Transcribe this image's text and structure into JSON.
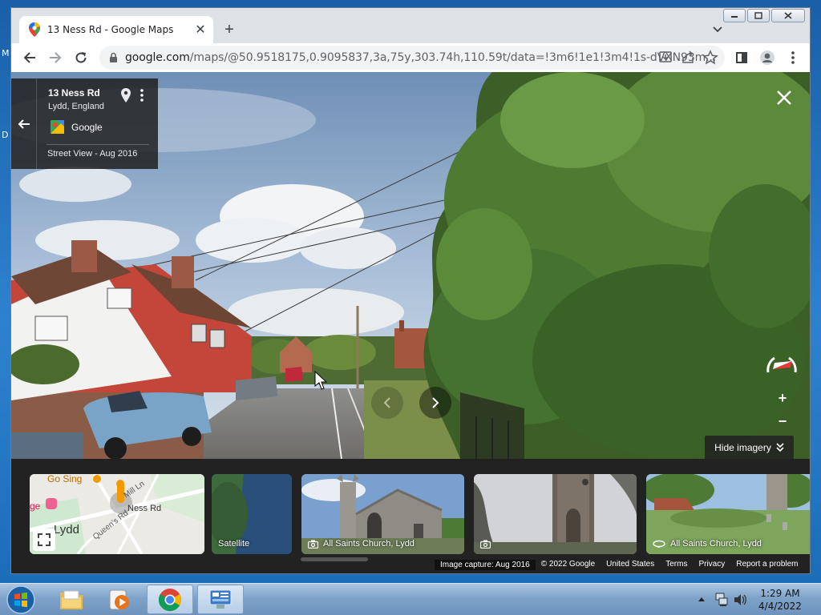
{
  "desktop": {
    "edge_letter_1": "M",
    "edge_letter_2": "D"
  },
  "browser": {
    "tab_title": "13 Ness Rd - Google Maps",
    "url_host": "google.com",
    "url_path": "/maps/@50.9518175,0.9095837,3a,75y,303.74h,110.59t/data=!3m6!1e1!3m4!1s-dVXN93m..."
  },
  "info_card": {
    "title": "13 Ness Rd",
    "subtitle": "Lydd, England",
    "provider": "Google",
    "date": "Street View - Aug 2016"
  },
  "controls": {
    "hide_imagery": "Hide imagery",
    "zoom_in": "+",
    "zoom_out": "−"
  },
  "map_thumb": {
    "labels": [
      "Go Sing",
      "Mill Ln",
      "Ness Rd",
      "Lydd",
      "Queen's Rd",
      "ge"
    ]
  },
  "filmstrip": {
    "items": [
      {
        "label": "Satellite"
      },
      {
        "label": "All Saints Church, Lydd",
        "icon": "camera-icon"
      },
      {
        "label": "",
        "icon": "camera-icon"
      },
      {
        "label": "All Saints Church, Lydd",
        "icon": "360-icon"
      }
    ]
  },
  "footer": {
    "capture": "Image capture: Aug 2016",
    "copyright": "© 2022 Google",
    "country": "United States",
    "terms": "Terms",
    "privacy": "Privacy",
    "report": "Report a problem"
  },
  "taskbar": {
    "time": "1:29 AM",
    "date": "4/4/2022"
  },
  "colors": {
    "chrome_frame": "#dee1e6",
    "panel_dark": "#222222",
    "taskbar": "#7ea3c9",
    "compass_red": "#e53935"
  }
}
